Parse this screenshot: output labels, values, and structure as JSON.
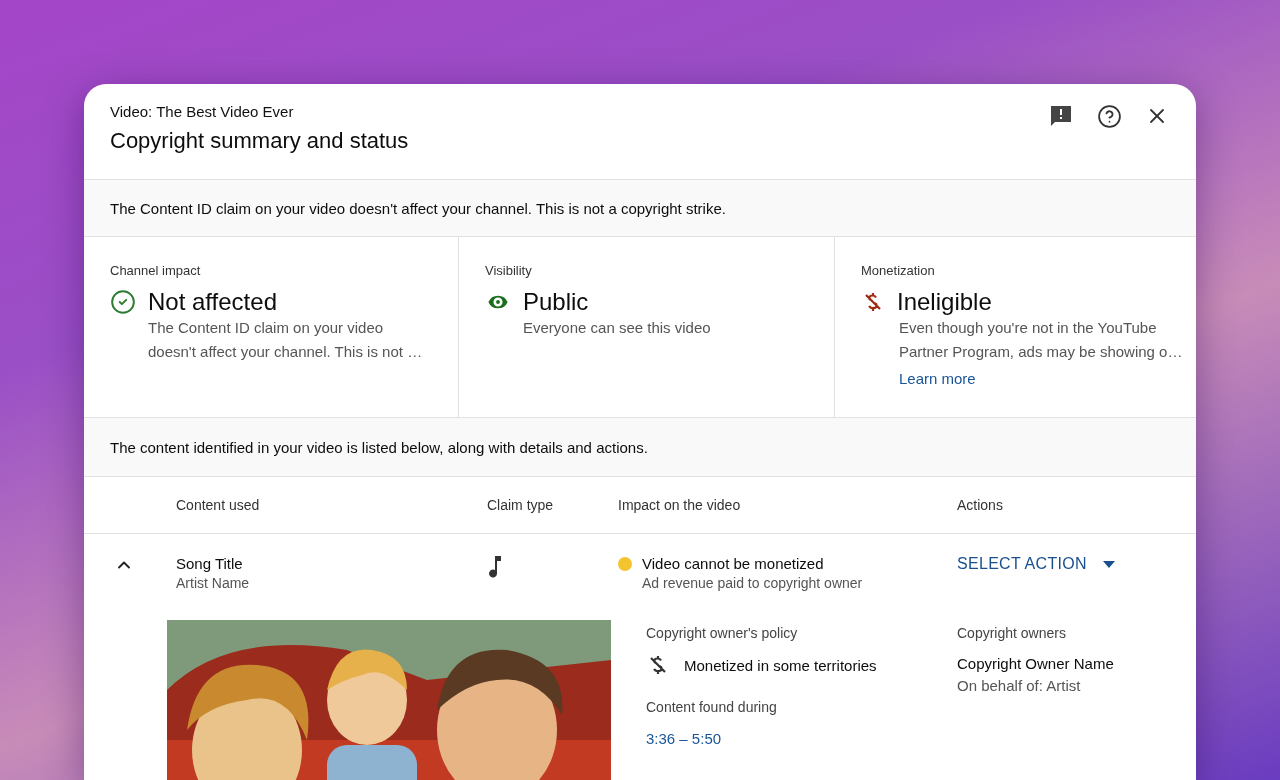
{
  "dialog": {
    "subtitle": "Video: The Best Video Ever",
    "title": "Copyright summary and status"
  },
  "notice": "The Content ID claim on your video doesn't affect your channel. This is not a copyright strike.",
  "status_cards": [
    {
      "kind": "impact",
      "label": "Channel impact",
      "value": "Not affected",
      "description": [
        "The Content ID claim on your video",
        "doesn't affect your channel. This is not …"
      ]
    },
    {
      "kind": "visibility",
      "label": "Visibility",
      "value": "Public",
      "description": [
        "Everyone can see this video"
      ]
    },
    {
      "kind": "monetization",
      "label": "Monetization",
      "value": "Ineligible",
      "description": [
        "Even though you're not in the YouTube",
        "Partner Program, ads may be showing o…"
      ],
      "link": "Learn more"
    }
  ],
  "content_notice": "The content identified in your video is listed below, along with details and actions.",
  "table": {
    "columns": [
      "Content used",
      "Claim type",
      "Impact on the video",
      "Actions"
    ],
    "rows": [
      {
        "expanded": true,
        "title": "Song Title",
        "artist": "Artist Name",
        "kind": "audio",
        "impact": "Video cannot be monetized",
        "impact_detail": "Ad revenue paid to copyright owner",
        "color": "#f4c430",
        "action": "SELECT ACTION",
        "details": {
          "policy_label": "Copyright owner's policy",
          "policy": "Monetized in some territories",
          "found_label": "Content found during",
          "found_range": "3:36 – 5:50",
          "owners_label": "Copyright owners",
          "owner_name": "Copyright Owner Name",
          "owner_behalf": "On behalf of: Artist"
        }
      }
    ]
  }
}
